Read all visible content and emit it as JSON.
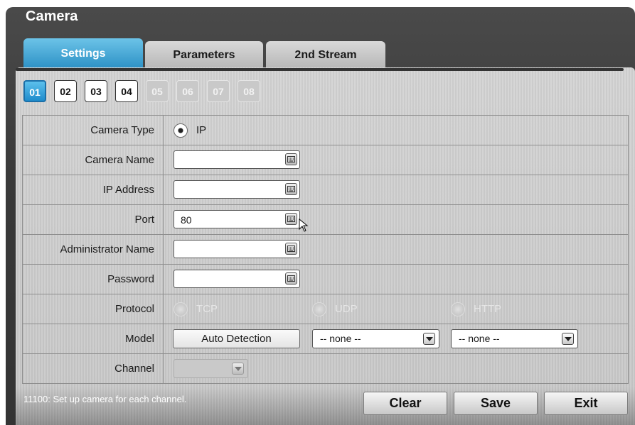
{
  "window": {
    "title": "Camera"
  },
  "tabs": [
    {
      "label": "Settings",
      "active": true
    },
    {
      "label": "Parameters",
      "active": false
    },
    {
      "label": "2nd Stream",
      "active": false
    }
  ],
  "channels": [
    {
      "label": "01",
      "state": "active"
    },
    {
      "label": "02",
      "state": "normal"
    },
    {
      "label": "03",
      "state": "normal"
    },
    {
      "label": "04",
      "state": "normal"
    },
    {
      "label": "05",
      "state": "disabled"
    },
    {
      "label": "06",
      "state": "disabled"
    },
    {
      "label": "07",
      "state": "disabled"
    },
    {
      "label": "08",
      "state": "disabled"
    }
  ],
  "form": {
    "camera_type": {
      "label": "Camera Type",
      "option": "IP"
    },
    "camera_name": {
      "label": "Camera Name",
      "value": ""
    },
    "ip_address": {
      "label": "IP Address",
      "value": ""
    },
    "port": {
      "label": "Port",
      "value": "80"
    },
    "admin_name": {
      "label": "Administrator Name",
      "value": ""
    },
    "password": {
      "label": "Password",
      "value": ""
    },
    "protocol": {
      "label": "Protocol",
      "options": [
        "TCP",
        "UDP",
        "HTTP"
      ]
    },
    "model": {
      "label": "Model",
      "auto_detect": "Auto Detection",
      "select1": "-- none --",
      "select2": "-- none --"
    },
    "channel": {
      "label": "Channel",
      "value": ""
    }
  },
  "status_text": "11100: Set up camera for each channel.",
  "buttons": {
    "clear": "Clear",
    "save": "Save",
    "exit": "Exit"
  },
  "colors": {
    "accent": "#2a8fc4",
    "window_bg": "#3a3a3a",
    "panel_bg": "#cfcfcf"
  }
}
